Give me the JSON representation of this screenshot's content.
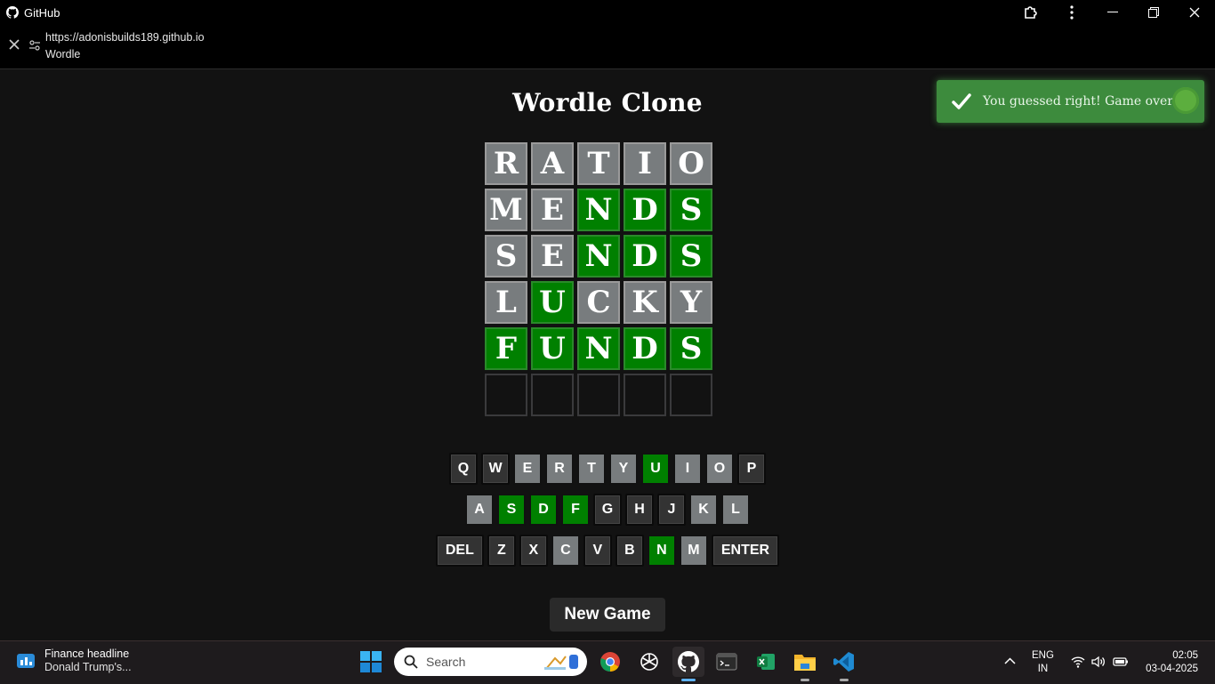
{
  "titlebar": {
    "app_name": "GitHub"
  },
  "urlbar": {
    "url": "https://adonisbuilds189.github.io",
    "page_title": "Wordle"
  },
  "game": {
    "title": "Wordle Clone",
    "board": [
      [
        {
          "l": "R",
          "s": "gray"
        },
        {
          "l": "A",
          "s": "gray"
        },
        {
          "l": "T",
          "s": "gray"
        },
        {
          "l": "I",
          "s": "gray"
        },
        {
          "l": "O",
          "s": "gray"
        }
      ],
      [
        {
          "l": "M",
          "s": "gray"
        },
        {
          "l": "E",
          "s": "gray"
        },
        {
          "l": "N",
          "s": "green"
        },
        {
          "l": "D",
          "s": "green"
        },
        {
          "l": "S",
          "s": "green"
        }
      ],
      [
        {
          "l": "S",
          "s": "gray"
        },
        {
          "l": "E",
          "s": "gray"
        },
        {
          "l": "N",
          "s": "green"
        },
        {
          "l": "D",
          "s": "green"
        },
        {
          "l": "S",
          "s": "green"
        }
      ],
      [
        {
          "l": "L",
          "s": "gray"
        },
        {
          "l": "U",
          "s": "green"
        },
        {
          "l": "C",
          "s": "gray"
        },
        {
          "l": "K",
          "s": "gray"
        },
        {
          "l": "Y",
          "s": "gray"
        }
      ],
      [
        {
          "l": "F",
          "s": "green"
        },
        {
          "l": "U",
          "s": "green"
        },
        {
          "l": "N",
          "s": "green"
        },
        {
          "l": "D",
          "s": "green"
        },
        {
          "l": "S",
          "s": "green"
        }
      ],
      [
        {
          "l": "",
          "s": "empty"
        },
        {
          "l": "",
          "s": "empty"
        },
        {
          "l": "",
          "s": "empty"
        },
        {
          "l": "",
          "s": "empty"
        },
        {
          "l": "",
          "s": "empty"
        }
      ]
    ],
    "keyboard": [
      [
        {
          "k": "Q",
          "s": "dark"
        },
        {
          "k": "W",
          "s": "dark"
        },
        {
          "k": "E",
          "s": "gray"
        },
        {
          "k": "R",
          "s": "gray"
        },
        {
          "k": "T",
          "s": "gray"
        },
        {
          "k": "Y",
          "s": "gray"
        },
        {
          "k": "U",
          "s": "green"
        },
        {
          "k": "I",
          "s": "gray"
        },
        {
          "k": "O",
          "s": "gray"
        },
        {
          "k": "P",
          "s": "dark"
        }
      ],
      [
        {
          "k": "A",
          "s": "gray"
        },
        {
          "k": "S",
          "s": "green"
        },
        {
          "k": "D",
          "s": "green"
        },
        {
          "k": "F",
          "s": "green"
        },
        {
          "k": "G",
          "s": "dark"
        },
        {
          "k": "H",
          "s": "dark"
        },
        {
          "k": "J",
          "s": "dark"
        },
        {
          "k": "K",
          "s": "gray"
        },
        {
          "k": "L",
          "s": "gray"
        }
      ],
      [
        {
          "k": "DEL",
          "s": "dark"
        },
        {
          "k": "Z",
          "s": "dark"
        },
        {
          "k": "X",
          "s": "dark"
        },
        {
          "k": "C",
          "s": "gray"
        },
        {
          "k": "V",
          "s": "dark"
        },
        {
          "k": "B",
          "s": "dark"
        },
        {
          "k": "N",
          "s": "green"
        },
        {
          "k": "M",
          "s": "gray"
        },
        {
          "k": "ENTER",
          "s": "dark"
        }
      ]
    ],
    "new_game_label": "New Game",
    "toast": "You guessed right! Game over!"
  },
  "colors": {
    "green": "#008000",
    "gray": "#787c7e",
    "key_dark": "#333333",
    "toast": "#3d8b3d"
  },
  "taskbar": {
    "widget_title": "Finance headline",
    "widget_sub": "Donald Trump's...",
    "search_placeholder": "Search",
    "apps": [
      "chrome-icon",
      "chatgpt-icon",
      "github-icon",
      "terminal-icon",
      "excel-icon",
      "file-explorer-icon",
      "vscode-icon"
    ],
    "lang1": "ENG",
    "lang2": "IN",
    "time": "02:05",
    "date": "03-04-2025"
  }
}
